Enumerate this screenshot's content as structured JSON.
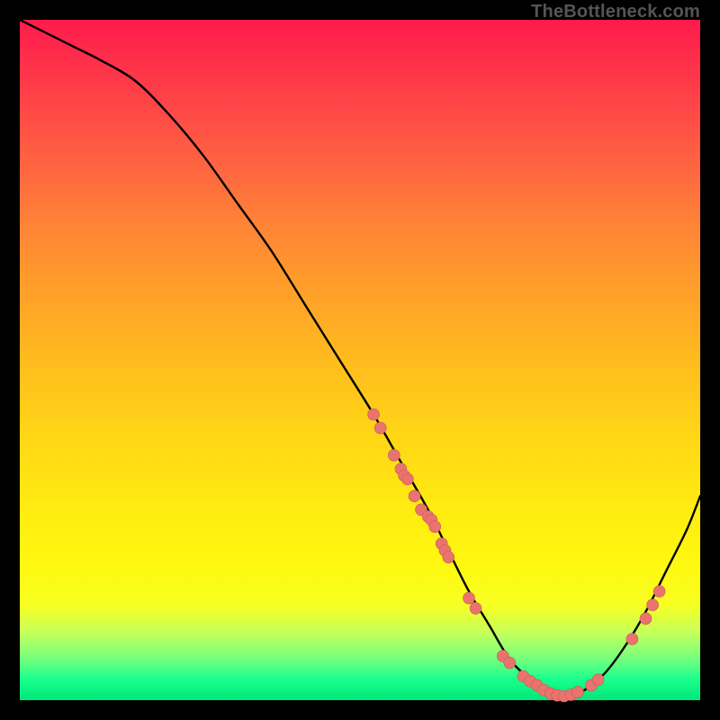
{
  "watermark": "TheBottleneck.com",
  "chart_data": {
    "type": "line",
    "title": "",
    "xlabel": "",
    "ylabel": "",
    "xlim": [
      0,
      100
    ],
    "ylim": [
      0,
      100
    ],
    "series": [
      {
        "name": "bottleneck-curve",
        "x": [
          0,
          4,
          8,
          12,
          17,
          22,
          27,
          32,
          37,
          42,
          47,
          52,
          56,
          60,
          63,
          66,
          69,
          72,
          75,
          77,
          80,
          83,
          86,
          89,
          92,
          95,
          98,
          100
        ],
        "y": [
          100,
          98,
          96,
          94,
          91,
          86,
          80,
          73,
          66,
          58,
          50,
          42,
          35,
          28,
          22,
          16,
          11,
          6,
          3,
          1,
          0.5,
          1.5,
          4,
          8,
          13,
          19,
          25,
          30
        ]
      }
    ],
    "markers": {
      "name": "highlight-points",
      "points": [
        {
          "x": 52,
          "y": 42
        },
        {
          "x": 53,
          "y": 40
        },
        {
          "x": 55,
          "y": 36
        },
        {
          "x": 56,
          "y": 34
        },
        {
          "x": 56.5,
          "y": 33
        },
        {
          "x": 57,
          "y": 32.5
        },
        {
          "x": 58,
          "y": 30
        },
        {
          "x": 59,
          "y": 28
        },
        {
          "x": 60,
          "y": 27
        },
        {
          "x": 60.5,
          "y": 26.5
        },
        {
          "x": 61,
          "y": 25.5
        },
        {
          "x": 62,
          "y": 23
        },
        {
          "x": 62.5,
          "y": 22
        },
        {
          "x": 63,
          "y": 21
        },
        {
          "x": 66,
          "y": 15
        },
        {
          "x": 67,
          "y": 13.5
        },
        {
          "x": 71,
          "y": 6.5
        },
        {
          "x": 72,
          "y": 5.5
        },
        {
          "x": 74,
          "y": 3.5
        },
        {
          "x": 75,
          "y": 2.8
        },
        {
          "x": 76,
          "y": 2.2
        },
        {
          "x": 77,
          "y": 1.5
        },
        {
          "x": 78,
          "y": 1
        },
        {
          "x": 79,
          "y": 0.7
        },
        {
          "x": 80,
          "y": 0.6
        },
        {
          "x": 81,
          "y": 0.8
        },
        {
          "x": 82,
          "y": 1.2
        },
        {
          "x": 84,
          "y": 2.2
        },
        {
          "x": 85,
          "y": 3
        },
        {
          "x": 90,
          "y": 9
        },
        {
          "x": 92,
          "y": 12
        },
        {
          "x": 93,
          "y": 14
        },
        {
          "x": 94,
          "y": 16
        }
      ]
    },
    "gradient_stops": [
      {
        "pos": 0,
        "color": "#ff1a4d"
      },
      {
        "pos": 50,
        "color": "#ffd316"
      },
      {
        "pos": 100,
        "color": "#00e676"
      }
    ],
    "marker_color": "#e9746e"
  }
}
